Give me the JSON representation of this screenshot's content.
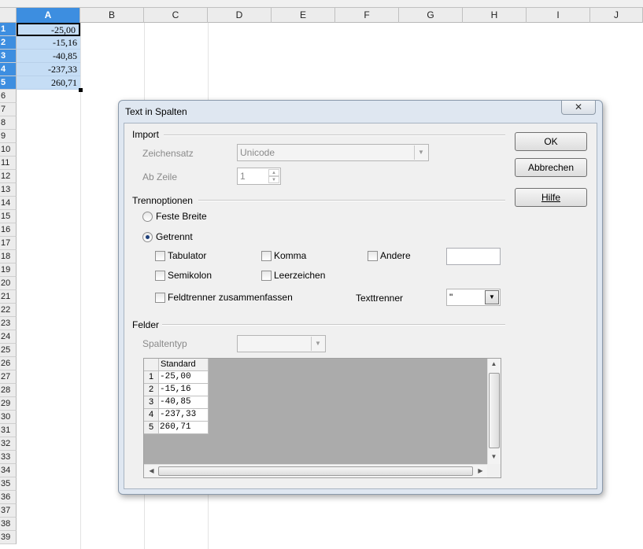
{
  "spreadsheet": {
    "columns": [
      "A",
      "B",
      "C",
      "D",
      "E",
      "F",
      "G",
      "H",
      "I",
      "J"
    ],
    "selected_column": "A",
    "rows": [
      "1",
      "2",
      "3",
      "4",
      "5",
      "6",
      "7",
      "8",
      "9",
      "10",
      "11",
      "12",
      "13",
      "14",
      "15",
      "16",
      "17",
      "18",
      "19",
      "20",
      "21",
      "22",
      "23",
      "24",
      "25",
      "26",
      "27",
      "28",
      "29",
      "30",
      "31",
      "32",
      "33",
      "34",
      "35",
      "36",
      "37",
      "38",
      "39"
    ],
    "selected_rows": [
      "1",
      "2",
      "3",
      "4",
      "5"
    ],
    "column_a_values": [
      "-25,00",
      "-15,16",
      "-40,85",
      "-237,33",
      "260,71"
    ]
  },
  "dialog": {
    "title": "Text in Spalten",
    "close_label": "✕",
    "buttons": {
      "ok": "OK",
      "cancel": "Abbrechen",
      "help": "Hilfe"
    },
    "import": {
      "group_label": "Import",
      "charset_label": "Zeichensatz",
      "charset_value": "Unicode",
      "from_row_label": "Ab Zeile",
      "from_row_value": "1"
    },
    "separator_options": {
      "group_label": "Trennoptionen",
      "fixed_width_label": "Feste Breite",
      "separated_label": "Getrennt",
      "selected": "separated",
      "tab_label": "Tabulator",
      "comma_label": "Komma",
      "other_label": "Andere",
      "semicolon_label": "Semikolon",
      "space_label": "Leerzeichen",
      "merge_label": "Feldtrenner zusammenfassen",
      "text_delimiter_label": "Texttrenner",
      "text_delimiter_value": "\"",
      "other_value": ""
    },
    "fields": {
      "group_label": "Felder",
      "column_type_label": "Spaltentyp",
      "column_type_value": "",
      "preview_header": "Standard",
      "preview_row_numbers": [
        "1",
        "2",
        "3",
        "4",
        "5"
      ],
      "preview_values": [
        "-25,00",
        "-15,16",
        "-40,85",
        "-237,33",
        "260,71"
      ]
    }
  }
}
